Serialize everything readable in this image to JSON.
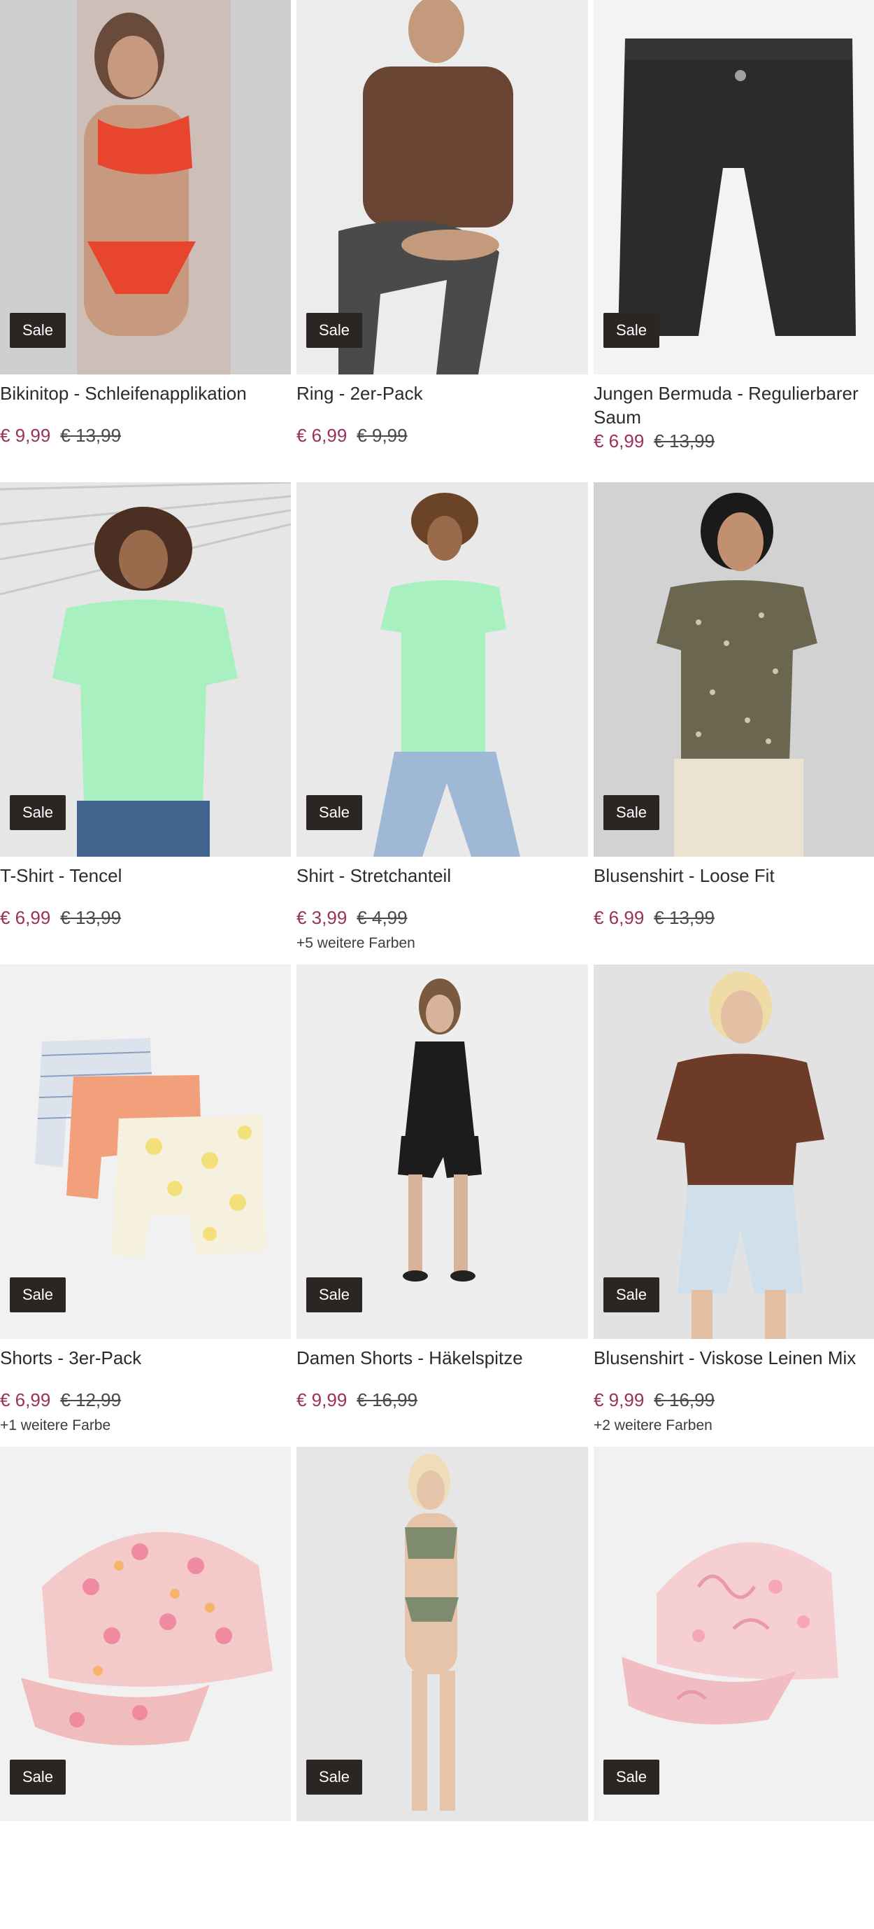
{
  "colors": {
    "sale_price": "#9b2f5e",
    "badge_bg": "#2b2523",
    "badge_text": "#ffffff"
  },
  "products": [
    {
      "title": "Bikinitop - Schleifenapplikation",
      "badge": "Sale",
      "price": "€ 9,99",
      "old_price": "€ 13,99",
      "more_colors": ""
    },
    {
      "title": "Ring - 2er-Pack",
      "badge": "Sale",
      "price": "€ 6,99",
      "old_price": "€ 9,99",
      "more_colors": ""
    },
    {
      "title": "Jungen Bermuda - Regulierbarer Saum",
      "badge": "Sale",
      "price": "€ 6,99",
      "old_price": "€ 13,99",
      "more_colors": ""
    },
    {
      "title": "T-Shirt - Tencel",
      "badge": "Sale",
      "price": "€ 6,99",
      "old_price": "€ 13,99",
      "more_colors": ""
    },
    {
      "title": "Shirt - Stretchanteil",
      "badge": "Sale",
      "price": "€ 3,99",
      "old_price": "€ 4,99",
      "more_colors": "+5 weitere Farben"
    },
    {
      "title": "Blusenshirt - Loose Fit",
      "badge": "Sale",
      "price": "€ 6,99",
      "old_price": "€ 13,99",
      "more_colors": ""
    },
    {
      "title": "Shorts - 3er-Pack",
      "badge": "Sale",
      "price": "€ 6,99",
      "old_price": "€ 12,99",
      "more_colors": "+1 weitere Farbe"
    },
    {
      "title": "Damen Shorts - Häkelspitze",
      "badge": "Sale",
      "price": "€ 9,99",
      "old_price": "€ 16,99",
      "more_colors": ""
    },
    {
      "title": "Blusenshirt - Viskose Leinen Mix",
      "badge": "Sale",
      "price": "€ 9,99",
      "old_price": "€ 16,99",
      "more_colors": "+2 weitere Farben"
    },
    {
      "title": "",
      "badge": "Sale",
      "price": "",
      "old_price": "",
      "more_colors": ""
    },
    {
      "title": "",
      "badge": "Sale",
      "price": "",
      "old_price": "",
      "more_colors": ""
    },
    {
      "title": "",
      "badge": "Sale",
      "price": "",
      "old_price": "",
      "more_colors": ""
    }
  ]
}
